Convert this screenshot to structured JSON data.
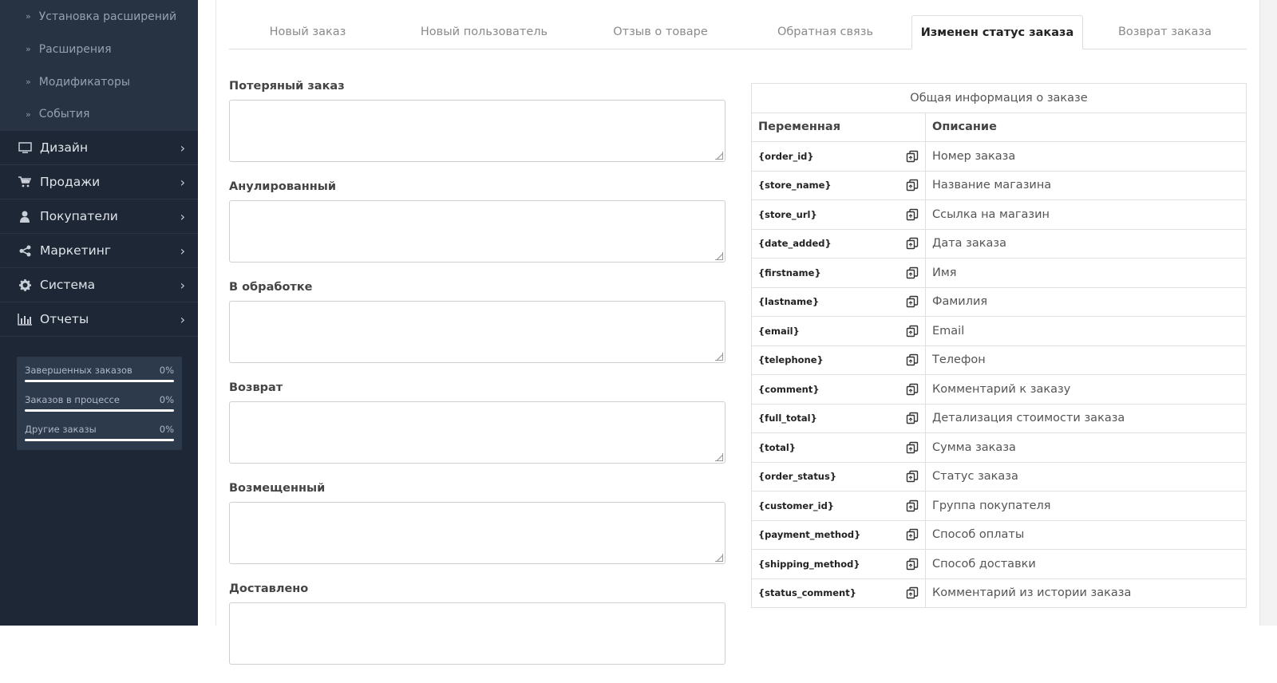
{
  "sidebar": {
    "sub_items": [
      {
        "label": "Установка расширений"
      },
      {
        "label": "Расширения"
      },
      {
        "label": "Модификаторы"
      },
      {
        "label": "События"
      }
    ],
    "main_items": [
      {
        "label": "Дизайн",
        "icon": "monitor-icon"
      },
      {
        "label": "Продажи",
        "icon": "cart-icon"
      },
      {
        "label": "Покупатели",
        "icon": "user-icon"
      },
      {
        "label": "Маркетинг",
        "icon": "share-icon"
      },
      {
        "label": "Система",
        "icon": "gear-icon"
      },
      {
        "label": "Отчеты",
        "icon": "bar-chart-icon"
      }
    ],
    "stats": [
      {
        "label": "Завершенных заказов",
        "value": "0%"
      },
      {
        "label": "Заказов в процессе",
        "value": "0%"
      },
      {
        "label": "Другие заказы",
        "value": "0%"
      }
    ]
  },
  "tabs": [
    {
      "label": "Новый заказ",
      "active": false
    },
    {
      "label": "Новый пользователь",
      "active": false
    },
    {
      "label": "Отзыв о товаре",
      "active": false
    },
    {
      "label": "Обратная связь",
      "active": false
    },
    {
      "label": "Изменен статус заказа",
      "active": true
    },
    {
      "label": "Возврат заказа",
      "active": false
    }
  ],
  "form": {
    "fields": [
      {
        "label": "Потеряный заказ",
        "value": ""
      },
      {
        "label": "Анулированный",
        "value": ""
      },
      {
        "label": "В обработке",
        "value": ""
      },
      {
        "label": "Возврат",
        "value": ""
      },
      {
        "label": "Возмещенный",
        "value": ""
      },
      {
        "label": "Доставлено",
        "value": ""
      }
    ]
  },
  "variables_table": {
    "caption": "Общая информация о заказе",
    "col_variable": "Переменная",
    "col_description": "Описание",
    "rows": [
      {
        "var": "{order_id}",
        "desc": "Номер заказа"
      },
      {
        "var": "{store_name}",
        "desc": "Название магазина"
      },
      {
        "var": "{store_url}",
        "desc": "Ссылка на магазин"
      },
      {
        "var": "{date_added}",
        "desc": "Дата заказа"
      },
      {
        "var": "{firstname}",
        "desc": "Имя"
      },
      {
        "var": "{lastname}",
        "desc": "Фамилия"
      },
      {
        "var": "{email}",
        "desc": "Email"
      },
      {
        "var": "{telephone}",
        "desc": "Телефон"
      },
      {
        "var": "{comment}",
        "desc": "Комментарий к заказу"
      },
      {
        "var": "{full_total}",
        "desc": "Детализация стоимости заказа"
      },
      {
        "var": "{total}",
        "desc": "Сумма заказа"
      },
      {
        "var": "{order_status}",
        "desc": "Статус заказа"
      },
      {
        "var": "{customer_id}",
        "desc": "Группа покупателя"
      },
      {
        "var": "{payment_method}",
        "desc": "Способ оплаты"
      },
      {
        "var": "{shipping_method}",
        "desc": "Способ доставки"
      },
      {
        "var": "{status_comment}",
        "desc": "Комментарий из истории заказа"
      }
    ]
  }
}
